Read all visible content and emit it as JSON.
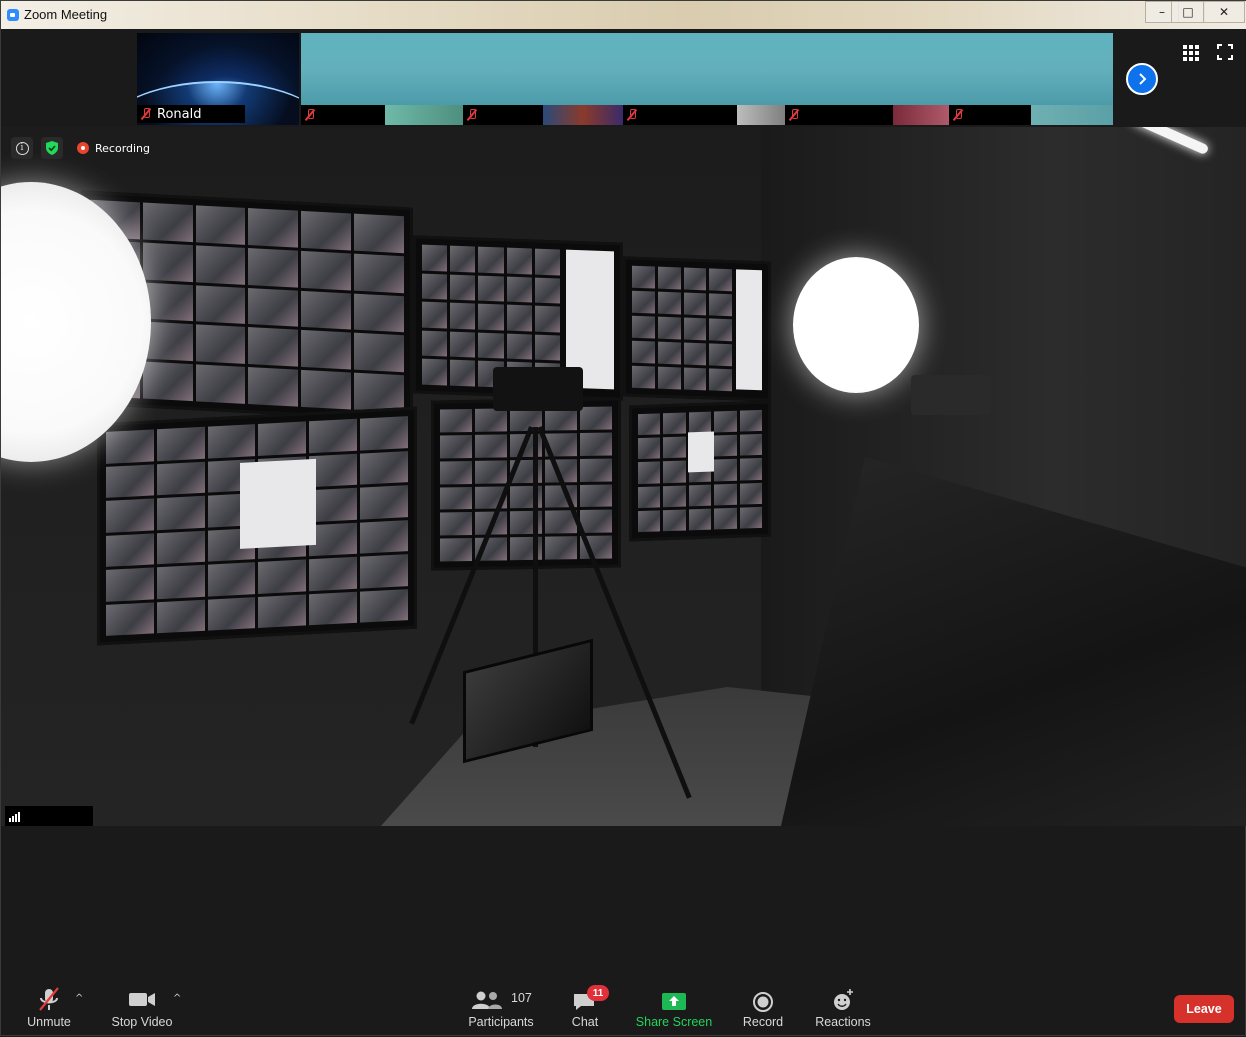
{
  "window": {
    "title": "Zoom Meeting",
    "controls": {
      "minimize": "–",
      "maximize": "□",
      "close": "✕"
    }
  },
  "gallery": {
    "tiles": [
      {
        "name": "Ronald",
        "muted": true,
        "icon": "microphone-muted-icon"
      },
      {
        "name": "",
        "muted": true,
        "icon": "microphone-muted-icon"
      },
      {
        "name": "",
        "muted": true,
        "icon": "microphone-muted-icon"
      },
      {
        "name": "",
        "muted": true,
        "icon": "microphone-muted-icon"
      },
      {
        "name": "",
        "muted": true,
        "icon": "microphone-muted-icon"
      },
      {
        "name": "",
        "muted": true,
        "icon": "microphone-muted-icon"
      }
    ],
    "next_icon": "chevron-right-icon",
    "view_icon": "grid-view-icon",
    "fullscreen_icon": "fullscreen-icon"
  },
  "status": {
    "info_icon": "info-icon",
    "security_icon": "shield-check-icon",
    "recording_label": "Recording"
  },
  "speaker": {
    "name": ""
  },
  "toolbar": {
    "unmute": "Unmute",
    "stop_video": "Stop Video",
    "participants": "Participants",
    "participants_count": "107",
    "chat": "Chat",
    "chat_badge": "11",
    "share_screen": "Share Screen",
    "record": "Record",
    "reactions": "Reactions",
    "leave": "Leave"
  },
  "colors": {
    "accent": "#0e72ed",
    "share_green": "#1db954",
    "leave_red": "#d6312b",
    "badge_red": "#e0303a",
    "recording_red": "#e8452c",
    "secure_green": "#23d959"
  }
}
